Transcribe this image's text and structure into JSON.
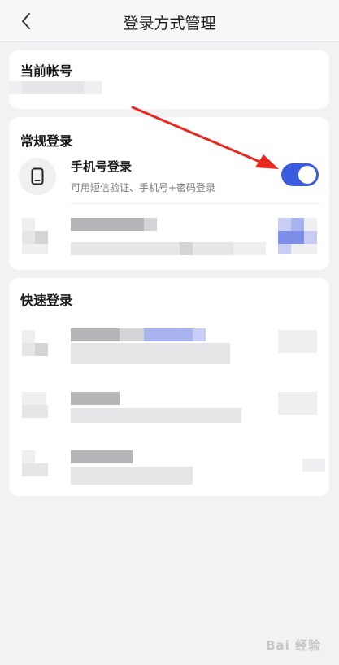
{
  "header": {
    "title": "登录方式管理"
  },
  "current_account": {
    "title": "当前帐号"
  },
  "regular_login": {
    "title": "常规登录",
    "phone": {
      "label": "手机号登录",
      "description": "可用短信验证、手机号+密码登录",
      "enabled": true
    }
  },
  "quick_login": {
    "title": "快速登录"
  },
  "watermark": {
    "text": "Bai 经验"
  },
  "colors": {
    "accent": "#3c5ce0",
    "annotation_arrow": "#e8281e"
  },
  "icons": {
    "back": "chevron-left-icon",
    "phone": "mobile-phone-icon"
  }
}
